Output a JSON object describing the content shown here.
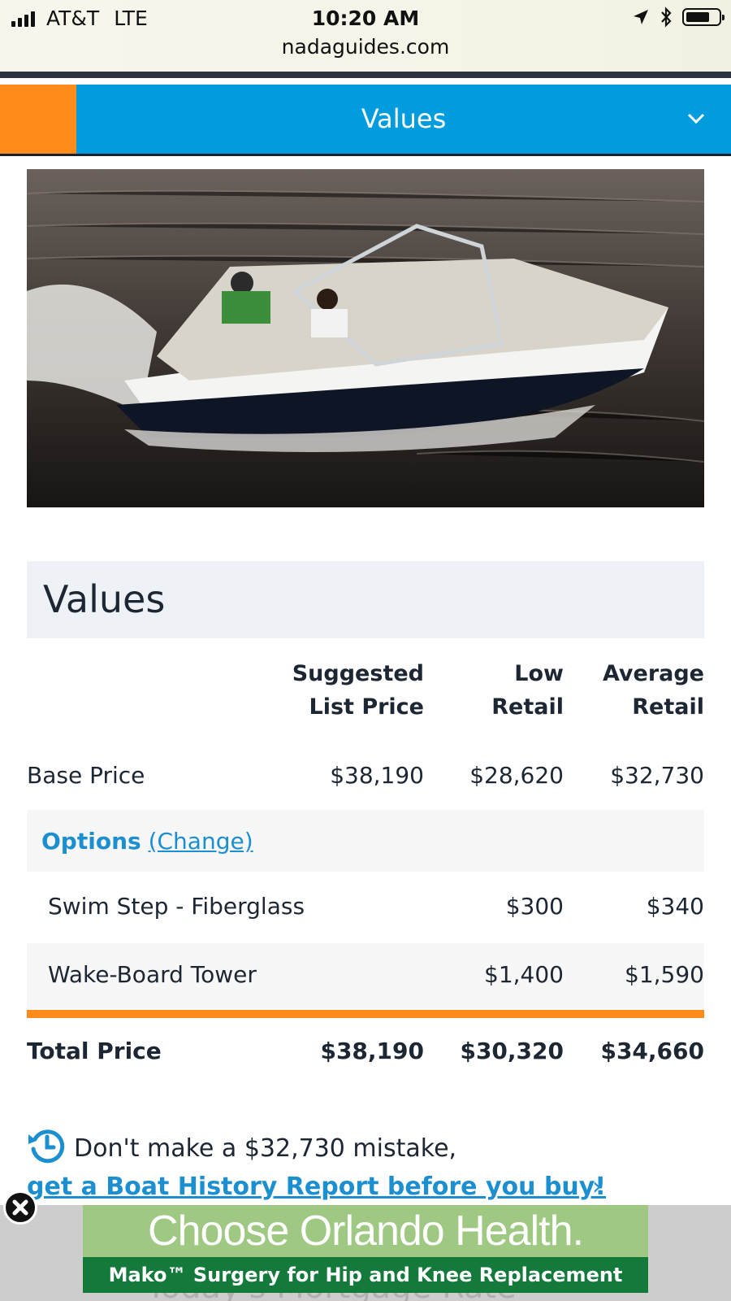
{
  "status_bar": {
    "carrier": "AT&T",
    "network": "LTE",
    "time": "10:20 AM",
    "url": "nadaguides.com"
  },
  "nav": {
    "title": "Values"
  },
  "values_section": {
    "heading": "Values",
    "columns": {
      "suggested_line1": "Suggested",
      "suggested_line2": "List Price",
      "low_line1": "Low",
      "low_line2": "Retail",
      "average_line1": "Average",
      "average_line2": "Retail"
    },
    "base": {
      "label": "Base Price",
      "suggested": "$38,190",
      "low": "$28,620",
      "average": "$32,730"
    },
    "options": {
      "label": "Options",
      "change_link": "(Change)",
      "items": [
        {
          "label": "Swim Step - Fiberglass",
          "low": "$300",
          "average": "$340"
        },
        {
          "label": "Wake-Board Tower",
          "low": "$1,400",
          "average": "$1,590"
        }
      ]
    },
    "total": {
      "label": "Total Price",
      "suggested": "$38,190",
      "low": "$30,320",
      "average": "$34,660"
    }
  },
  "cta": {
    "message": "Don't make a $32,730 mistake,",
    "link_text": "get a Boat History Report before you buy!"
  },
  "ad": {
    "headline": "Choose Orlando Health.",
    "subline": "Mako™ Surgery for Hip and Knee Replacement",
    "background_text": "Today's Mortgage Rate"
  }
}
